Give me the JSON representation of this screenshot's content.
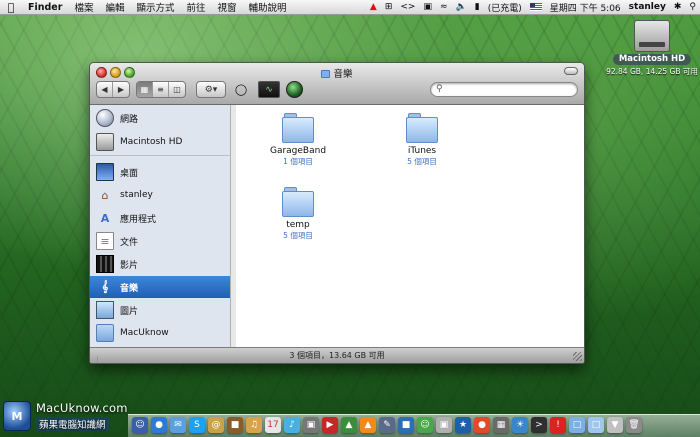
{
  "menubar": {
    "app": "Finder",
    "items": [
      "檔案",
      "編輯",
      "顯示方式",
      "前往",
      "視窗",
      "輔助說明"
    ],
    "input_status": "(已充電)",
    "clock": "星期四 下午 5:06",
    "user": "stanley"
  },
  "desktop": {
    "drive_label": "Macintosh HD",
    "drive_info": "92.84 GB, 14.25 GB 可用"
  },
  "window": {
    "title": "音樂",
    "search_placeholder": "",
    "status": "3 個項目，13.64 GB 可用"
  },
  "sidebar": {
    "items": [
      {
        "label": "網路",
        "icon": "network-icon"
      },
      {
        "label": "Macintosh HD",
        "icon": "hard-drive-icon"
      },
      {
        "label": "桌面",
        "icon": "desktop-icon"
      },
      {
        "label": "stanley",
        "icon": "home-icon"
      },
      {
        "label": "應用程式",
        "icon": "applications-icon"
      },
      {
        "label": "文件",
        "icon": "documents-icon"
      },
      {
        "label": "影片",
        "icon": "movies-icon"
      },
      {
        "label": "音樂",
        "icon": "music-icon",
        "selected": true
      },
      {
        "label": "圖片",
        "icon": "pictures-icon"
      },
      {
        "label": "MacUknow",
        "icon": "folder-icon"
      }
    ]
  },
  "files": [
    {
      "name": "GarageBand",
      "count": "1 個項目"
    },
    {
      "name": "iTunes",
      "count": "5 個項目"
    },
    {
      "name": "temp",
      "count": "5 個項目"
    }
  ],
  "watermark": {
    "site": "MacUknow.com",
    "subtitle": "蘋果電腦知識網"
  },
  "colors": {
    "selection": "#2a6fc7",
    "sidebar_bg": "#dfe5ee",
    "file_count": "#3a6fc9"
  }
}
